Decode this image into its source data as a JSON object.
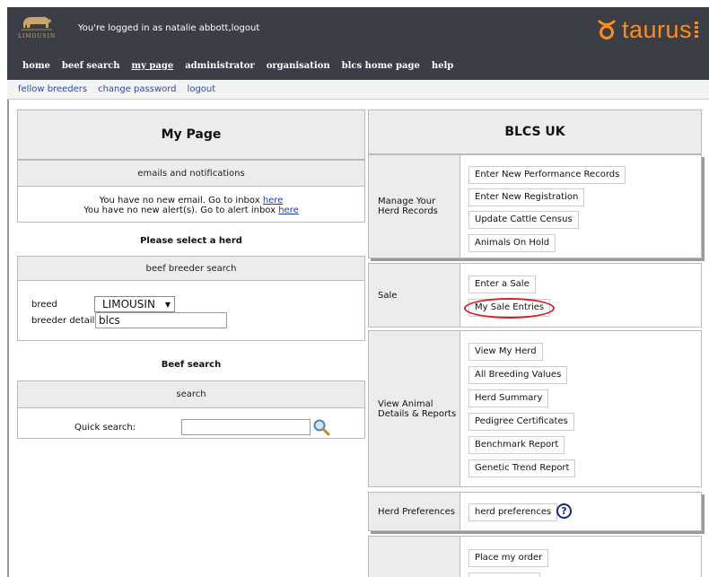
{
  "header": {
    "logo_text": "LIMOUSIN",
    "login_text": "You're logged in as natalie abbott,logout",
    "brand": "taurus",
    "brand_color": "#ff8c1a"
  },
  "nav": [
    {
      "label": "home",
      "active": false
    },
    {
      "label": "beef search",
      "active": false
    },
    {
      "label": "my page",
      "active": true
    },
    {
      "label": "administrator",
      "active": false
    },
    {
      "label": "organisation",
      "active": false
    },
    {
      "label": "blcs home page",
      "active": false
    },
    {
      "label": "help",
      "active": false
    }
  ],
  "subnav": [
    "fellow breeders",
    "change password",
    "logout"
  ],
  "left": {
    "title": "My Page",
    "emails": {
      "heading": "emails and notifications",
      "line1_prefix": "You have no new email. Go to inbox ",
      "line1_link": "here",
      "line2_prefix": "You have no new alert(s). Go to alert inbox ",
      "line2_link": "here"
    },
    "select_herd": "Please select a herd",
    "breeder_search": {
      "heading": "beef breeder search",
      "breed_label": "breed",
      "breed_value": "LIMOUSIN",
      "detail_label": "breeder detail",
      "detail_value": "blcs"
    },
    "beef_search_title": "Beef search",
    "search": {
      "heading": "search",
      "quick_label": "Quick search:",
      "quick_value": ""
    }
  },
  "right": {
    "title": "BLCS UK",
    "sections": {
      "herd_records": {
        "label_line1": "Manage Your",
        "label_line2": "Herd Records",
        "buttons": [
          "Enter New Performance Records",
          "Enter New Registration",
          "Update Cattle Census",
          "Animals On Hold"
        ]
      },
      "sale": {
        "label": "Sale",
        "buttons": [
          "Enter a Sale",
          "My Sale Entries"
        ]
      },
      "animal_details": {
        "label_line1": "View Animal",
        "label_line2": "Details & Reports",
        "buttons": [
          "View My Herd",
          "All Breeding Values",
          "Herd Summary",
          "Pedigree Certificates",
          "Benchmark Report",
          "Genetic Trend Report"
        ]
      },
      "preferences": {
        "label": "Herd Preferences",
        "buttons": [
          "herd preferences"
        ]
      },
      "orders": {
        "buttons": [
          "Place my order"
        ]
      }
    }
  },
  "highlight_color": "#d61f1f"
}
